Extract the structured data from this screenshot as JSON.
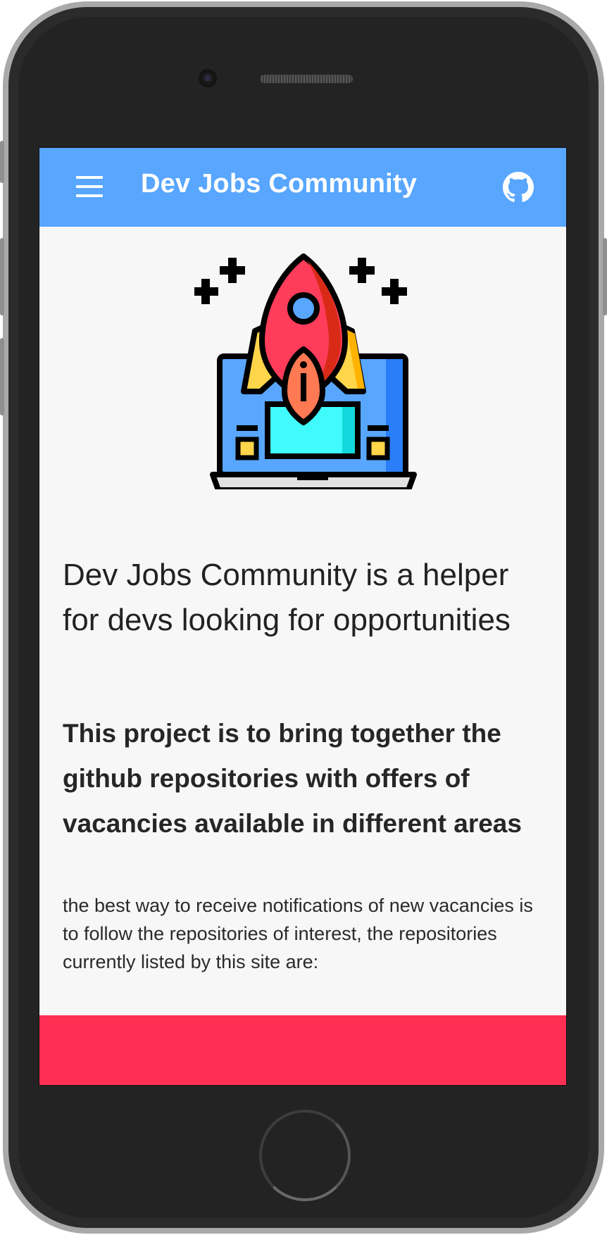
{
  "appbar": {
    "title": "Dev Jobs Community",
    "menu_icon": "hamburger-menu-icon",
    "github_icon": "github-icon",
    "color": "#58a6fe"
  },
  "hero": {
    "illustration": "rocket-laptop-illustration"
  },
  "content": {
    "headline": "Dev Jobs Community is a helper for devs looking for opportunities",
    "subheadline": "This project is to bring together the github repositories with offers of vacancies available in different areas",
    "body": "the best way to receive notifications of new vacancies is to follow the repositories of interest, the repositories currently listed by this site are:"
  },
  "footer_band": {
    "color": "#ff2e53"
  }
}
